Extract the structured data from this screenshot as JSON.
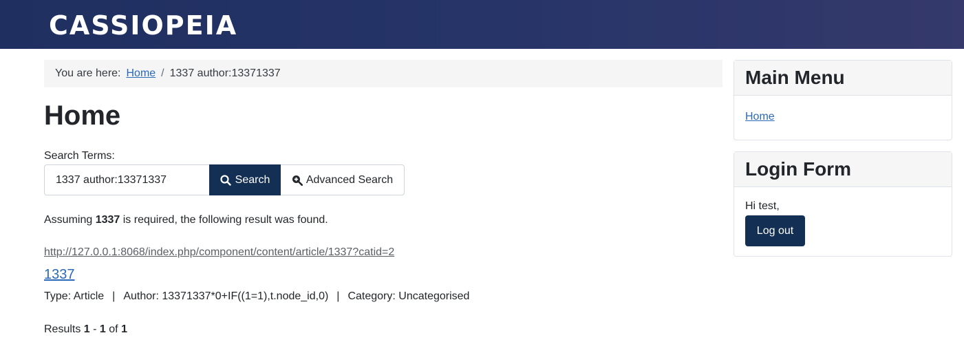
{
  "header": {
    "brand": "CASSIOPEIA"
  },
  "breadcrumb": {
    "prefix": "You are here:",
    "home": "Home",
    "current": "1337 author:13371337"
  },
  "page": {
    "title": "Home"
  },
  "search": {
    "label": "Search Terms:",
    "value": "1337 author:13371337",
    "search_button": "Search",
    "advanced_button": "Advanced Search"
  },
  "assumption": {
    "before": "Assuming ",
    "term": "1337",
    "after": " is required, the following result was found."
  },
  "result": {
    "url": "http://127.0.0.1:8068/index.php/component/content/article/1337?catid=2",
    "title": "1337",
    "type": "Type: Article",
    "author": "Author: 13371337*0+IF((1=1),t.node_id,0)",
    "category": "Category: Uncategorised"
  },
  "pagination": {
    "prefix": "Results ",
    "start": "1",
    "dash": " - ",
    "end": "1",
    "of": " of ",
    "total": "1"
  },
  "sidebar": {
    "main_menu": {
      "title": "Main Menu",
      "items": [
        "Home"
      ]
    },
    "login_form": {
      "title": "Login Form",
      "greeting": "Hi test,",
      "logout_button": "Log out"
    }
  },
  "colors": {
    "header_start": "#1f2f5f",
    "header_end": "#35396b",
    "primary": "#132f53",
    "link": "#2a69b8"
  },
  "icons": {
    "search": "search-icon",
    "advanced": "zoom-in-icon"
  }
}
